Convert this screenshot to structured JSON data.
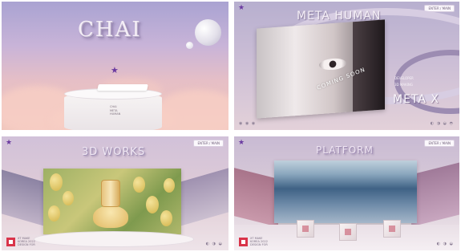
{
  "panels": {
    "chai": {
      "title": "CHAI",
      "pedestal_lines": [
        "CHAI",
        "META",
        "HUMAN"
      ]
    },
    "metahuman": {
      "enter_label": "ENTER / MAIN",
      "title": "META HUMAN",
      "subtitle": "",
      "coming_soon": "COMING SOON",
      "info_lines": [
        "DEVELOPER",
        "3D MAKING"
      ],
      "brand": "META X",
      "footer_icons": "◐ ◑ ◒ ◓"
    },
    "works": {
      "enter_label": "ENTER / MAIN",
      "title": "3D WORKS",
      "subtitle": "",
      "logo_lines": [
        "XT MAKE",
        "KOREA 2022",
        "DESIGN FOR"
      ],
      "footer_icons": "◐ ◑ ◒"
    },
    "platform": {
      "enter_label": "ENTER / MAIN",
      "title": "PLATFORM",
      "logo_lines": [
        "XT MAKE",
        "KOREA 2022",
        "DESIGN FOR"
      ],
      "footer_icons": "◐ ◑ ◒"
    }
  },
  "icons": {
    "star": "★",
    "social": "◉ ◉ ◉"
  },
  "colors": {
    "star": "#6a3aa0",
    "logo_red": "#d9344a"
  }
}
